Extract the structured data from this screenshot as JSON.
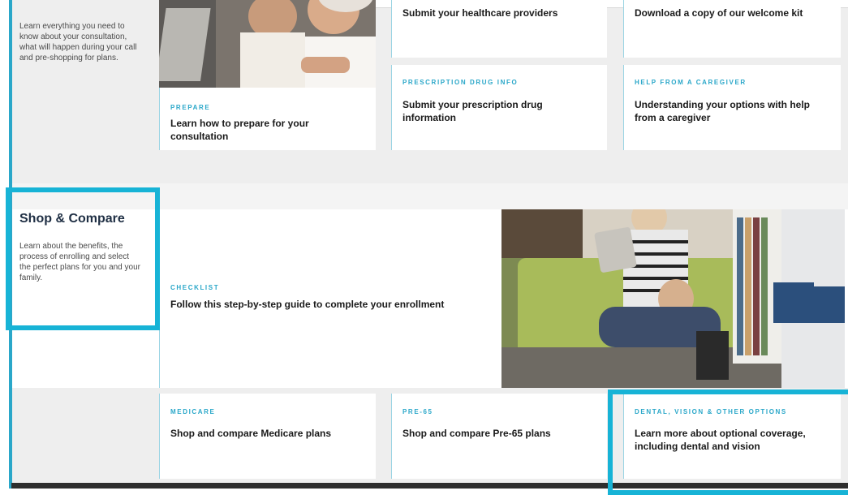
{
  "sections": {
    "consultation": {
      "description": "Learn everything you need to know about your consultation, what will happen during your call and pre-shopping for plans."
    },
    "shop": {
      "title": "Shop & Compare",
      "description": "Learn about the benefits, the process of enrolling and select the perfect plans for you and your family."
    }
  },
  "cards": {
    "prepare": {
      "eyebrow": "PREPARE",
      "title": "Learn how to prepare for your consultation"
    },
    "providers": {
      "title": "Submit your healthcare providers"
    },
    "welcome_kit": {
      "title": "Download a copy of our welcome kit"
    },
    "prescription": {
      "eyebrow": "PRESCRIPTION DRUG INFO",
      "title": "Submit your prescription drug information"
    },
    "caregiver": {
      "eyebrow": "HELP FROM A CAREGIVER",
      "title": "Understanding your options with help from a caregiver"
    },
    "checklist": {
      "eyebrow": "CHECKLIST",
      "title": "Follow this step-by-step guide to complete your enrollment"
    },
    "medicare": {
      "eyebrow": "MEDICARE",
      "title": "Shop and compare Medicare plans"
    },
    "pre65": {
      "eyebrow": "PRE-65",
      "title": "Shop and compare Pre-65 plans"
    },
    "dental": {
      "eyebrow": "DENTAL, VISION & OTHER OPTIONS",
      "title": "Learn more about optional coverage, including dental and vision"
    }
  },
  "colors": {
    "accent": "#2aa7c9",
    "highlight": "#17b3d6",
    "panel": "#eeeeee"
  }
}
